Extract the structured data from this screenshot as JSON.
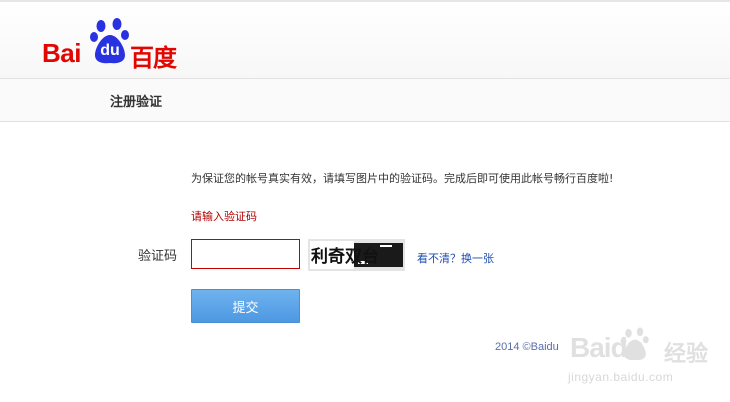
{
  "brand": {
    "logo_latin": "Bai",
    "logo_du": "du",
    "logo_chinese": "百度",
    "accent_red": "#e10601",
    "paw_blue": "#2932e1"
  },
  "subheader": {
    "title": "注册验证"
  },
  "form": {
    "notice": "为保证您的帐号真实有效，请填写图片中的验证码。完成后即可使用此帐号畅行百度啦!",
    "error": "请输入验证码",
    "captcha_label": "验证码",
    "captcha_value": "",
    "captcha_text": "利奇双台",
    "refresh_link": "看不清？换一张",
    "submit_label": "提交"
  },
  "footer": {
    "copyright": "2014 ©Baidu"
  },
  "watermark": {
    "brand": "Baidu",
    "chinese": "经验",
    "url": "jingyan.baidu.com"
  },
  "colors": {
    "error_border": "#c80000",
    "link": "#1e4eb0",
    "button": "#4d98e3"
  }
}
